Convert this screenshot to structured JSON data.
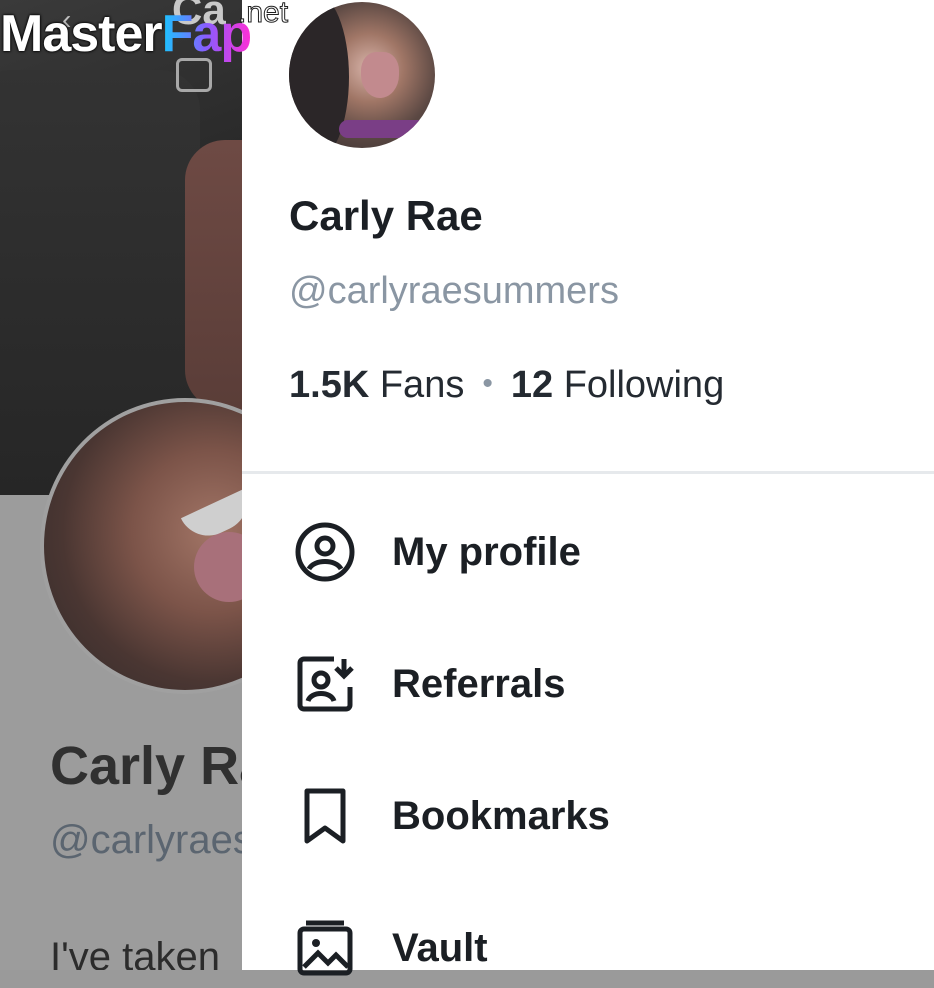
{
  "watermark": {
    "part1": "Master",
    "part2": "Fap",
    "suffix": ".net"
  },
  "background_profile": {
    "title_fragment": "Ca",
    "name_fragment": "Carly Ra",
    "handle_fragment": "@carlyraes",
    "bio_fragment": "I've taken"
  },
  "drawer": {
    "name": "Carly Rae",
    "handle": "@carlyraesummers",
    "fans_count": "1.5K",
    "fans_label": "Fans",
    "separator": "•",
    "following_count": "12",
    "following_label": "Following",
    "menu": [
      {
        "label": "My profile",
        "icon": "user-circle-icon"
      },
      {
        "label": "Referrals",
        "icon": "referral-icon"
      },
      {
        "label": "Bookmarks",
        "icon": "bookmark-icon"
      },
      {
        "label": "Vault",
        "icon": "vault-icon"
      }
    ]
  },
  "colors": {
    "drawer_bg": "#ffffff",
    "text_primary": "#1b1f24",
    "text_secondary": "#8a96a3",
    "overlay": "#9a9a9a"
  }
}
